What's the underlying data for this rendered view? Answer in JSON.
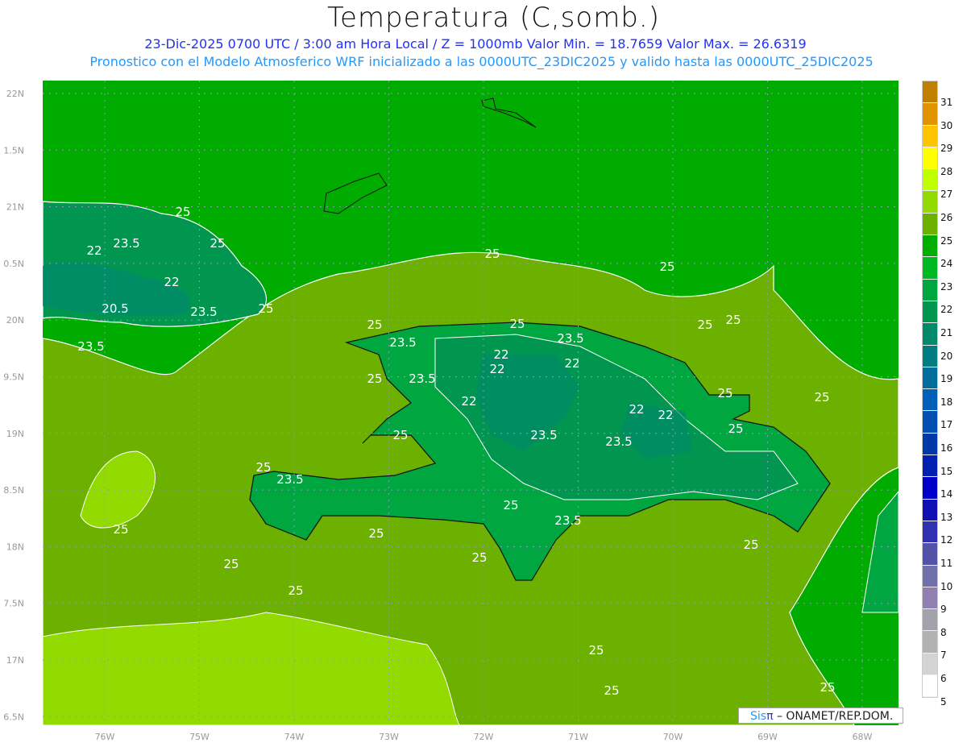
{
  "header": {
    "title": "Temperatura (C,somb.)",
    "subtitle": "23-Dic-2025  0700 UTC / 3:00 am Hora Local / Z = 1000mb   Valor Min. = 18.7659  Valor Max. = 26.6319",
    "model_info": "Pronostico con el Modelo Atmosferico WRF inicializado a las 0000UTC_23DIC2025 y valido hasta las  0000UTC_25DIC2025"
  },
  "map": {
    "lat_labels": [
      "22N",
      "1.5N",
      "21N",
      "0.5N",
      "20N",
      "9.5N",
      "19N",
      "8.5N",
      "18N",
      "7.5N",
      "17N",
      "6.5N"
    ],
    "lon_labels": [
      "76W",
      "75W",
      "74W",
      "73W",
      "72W",
      "71W",
      "70W",
      "69W",
      "68W"
    ],
    "contour_labels": [
      "25",
      "23.5",
      "25",
      "22",
      "22",
      "20.5",
      "23.5",
      "25",
      "23.5",
      "25",
      "25",
      "25",
      "25",
      "23.5",
      "22",
      "22",
      "22",
      "23.5",
      "22",
      "23.5",
      "23.5",
      "22",
      "23.5",
      "23.5",
      "25",
      "22",
      "25",
      "25",
      "25",
      "25",
      "25",
      "25",
      "25",
      "25",
      "25",
      "25",
      "25",
      "25",
      "25",
      "23.5",
      "25",
      "25",
      "25",
      "25"
    ]
  },
  "colorbar": {
    "labels": [
      "31",
      "30",
      "29",
      "28",
      "27",
      "26",
      "25",
      "24",
      "23",
      "22",
      "21",
      "20",
      "19",
      "18",
      "17",
      "16",
      "15",
      "14",
      "13",
      "12",
      "11",
      "10",
      "9",
      "8",
      "7",
      "6",
      "5"
    ],
    "colors": [
      "#c07f00",
      "#e09400",
      "#ffc400",
      "#ffff00",
      "#bfff00",
      "#93da00",
      "#6cb000",
      "#00ad00",
      "#00b922",
      "#00a640",
      "#00964f",
      "#008a6a",
      "#007d80",
      "#006d9c",
      "#0060b8",
      "#0050b2",
      "#0038aa",
      "#0020b0",
      "#0000c8",
      "#1010b4",
      "#3030b0",
      "#5252a8",
      "#7070aa",
      "#9080b2",
      "#a2a2aa",
      "#b2b2b2",
      "#d4d4d4",
      "#ffffff"
    ]
  },
  "credit": {
    "brand_a": "Sis",
    "brand_b": "π",
    "text": " –  ONAMET/REP.DOM."
  }
}
